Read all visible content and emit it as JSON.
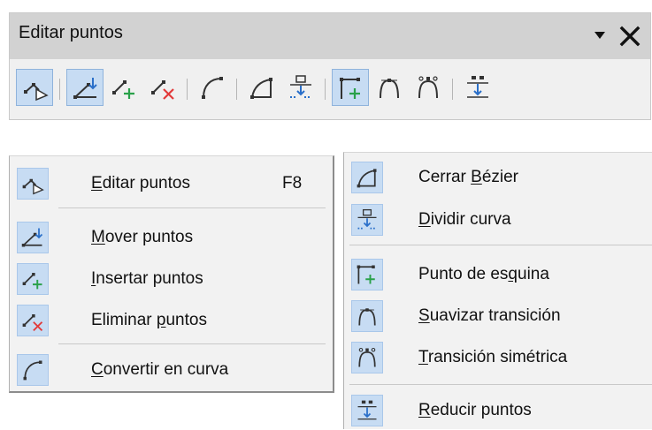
{
  "toolbar": {
    "title": "Editar puntos",
    "menu_icon": "triangle-down-icon",
    "close_icon": "close-icon"
  },
  "menu_left": {
    "items": [
      {
        "pre": "",
        "key": "E",
        "post": "ditar puntos",
        "shortcut": "F8",
        "icon": "edit-points-icon"
      },
      {
        "pre": "",
        "key": "M",
        "post": "over puntos",
        "icon": "move-points-icon"
      },
      {
        "pre": "",
        "key": "I",
        "post": "nsertar puntos",
        "icon": "insert-points-icon"
      },
      {
        "pre": "Eliminar ",
        "key": "p",
        "post": "untos",
        "icon": "delete-points-icon"
      },
      {
        "pre": "",
        "key": "C",
        "post": "onvertir en curva",
        "icon": "convert-to-curve-icon"
      }
    ]
  },
  "menu_right": {
    "items": [
      {
        "pre": "Cerrar ",
        "key": "B",
        "post": "ézier",
        "icon": "close-bezier-icon"
      },
      {
        "pre": "",
        "key": "D",
        "post": "ividir curva",
        "icon": "split-curve-icon"
      },
      {
        "pre": "Punto de es",
        "key": "q",
        "post": "uina",
        "icon": "corner-point-icon"
      },
      {
        "pre": "",
        "key": "S",
        "post": "uavizar transición",
        "icon": "smooth-transition-icon"
      },
      {
        "pre": "",
        "key": "T",
        "post": "ransición simétrica",
        "icon": "symmetric-transition-icon"
      },
      {
        "pre": "",
        "key": "R",
        "post": "educir puntos",
        "icon": "reduce-points-icon"
      }
    ]
  },
  "colors": {
    "highlight": "#c7dcf3",
    "titlebar": "#d2d2d2",
    "accent_blue": "#2a6fc9",
    "accent_green": "#2aa14a",
    "accent_red": "#e23a3a"
  }
}
